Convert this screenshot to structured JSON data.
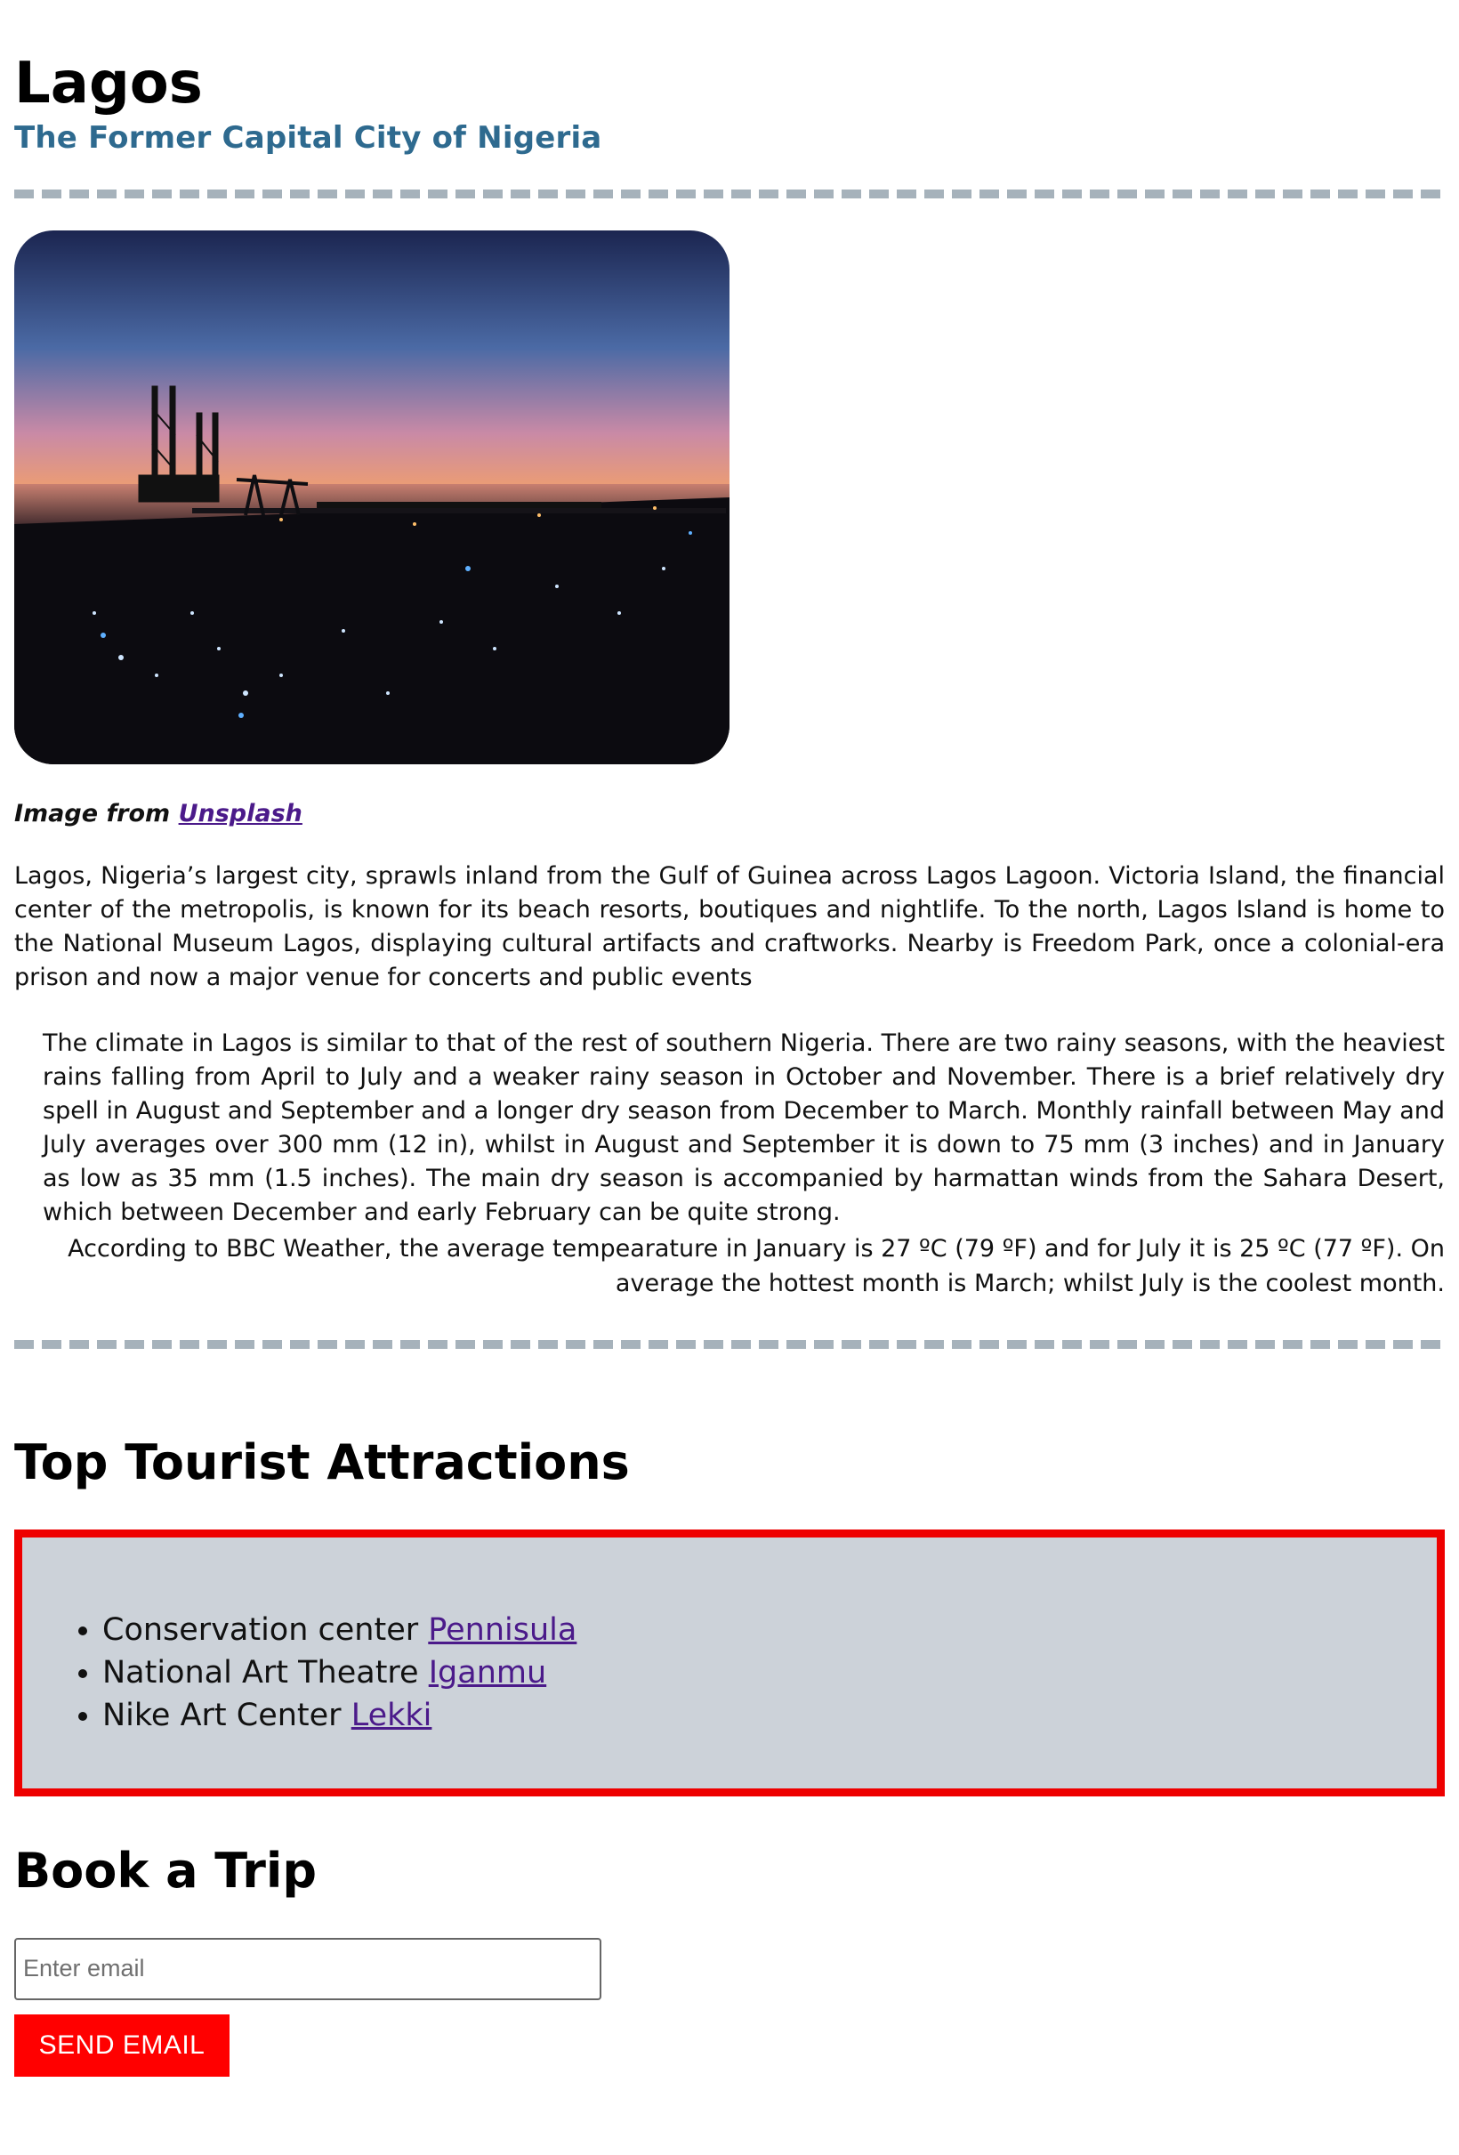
{
  "header": {
    "title": "Lagos",
    "subtitle": "The Former Capital City of Nigeria"
  },
  "hero_image": {
    "alt": "Lagos sunset over the harbour"
  },
  "caption": {
    "prefix": "Image from",
    "link_label": "Unsplash"
  },
  "intro": "Lagos, Nigeria’s largest city, sprawls inland from the Gulf of Guinea across Lagos Lagoon. Victoria Island, the financial center of the metropolis, is known for its beach resorts, boutiques and nightlife. To the north, Lagos Island is home to the National Museum Lagos, displaying cultural artifacts and craftworks. Nearby is Freedom Park, once a colonial-era prison and now a major venue for concerts and public events",
  "climate": {
    "paragraph_1": "The climate in Lagos is similar to that of the rest of southern Nigeria. There are two rainy seasons, with the heaviest rains falling from April to July and a weaker rainy season in October and November. There is a brief relatively dry spell in August and September and a longer dry season from December to March. Monthly rainfall between May and July averages over 300 mm (12 in), whilst in August and September it is down to 75 mm (3 inches) and in January as low as 35 mm (1.5 inches). The main dry season is accompanied by harmattan winds from the Sahara Desert, which between December and early February can be quite strong.",
    "paragraph_2": "According to BBC Weather, the average tempearature in January is 27 ºC (79 ºF) and for July it is 25 ºC (77 ºF). On average the hottest month is March; whilst July is the coolest month."
  },
  "attractions": {
    "heading": "Top Tourist Attractions",
    "items": [
      {
        "label": "Conservation center",
        "link": "Pennisula"
      },
      {
        "label": "National Art Theatre",
        "link": "Iganmu"
      },
      {
        "label": "Nike Art Center",
        "link": "Lekki"
      }
    ],
    "border_color": "#ee0000",
    "background_color": "#ccd2d9"
  },
  "booking": {
    "heading": "Book a Trip",
    "email_placeholder": "Enter email",
    "email_value": "",
    "button_label": "SEND EMAIL",
    "button_color": "#ff0000"
  },
  "colors": {
    "subtitle": "#2e6a8f",
    "link": "#4b1a8a",
    "divider": "#a6b2bb"
  }
}
